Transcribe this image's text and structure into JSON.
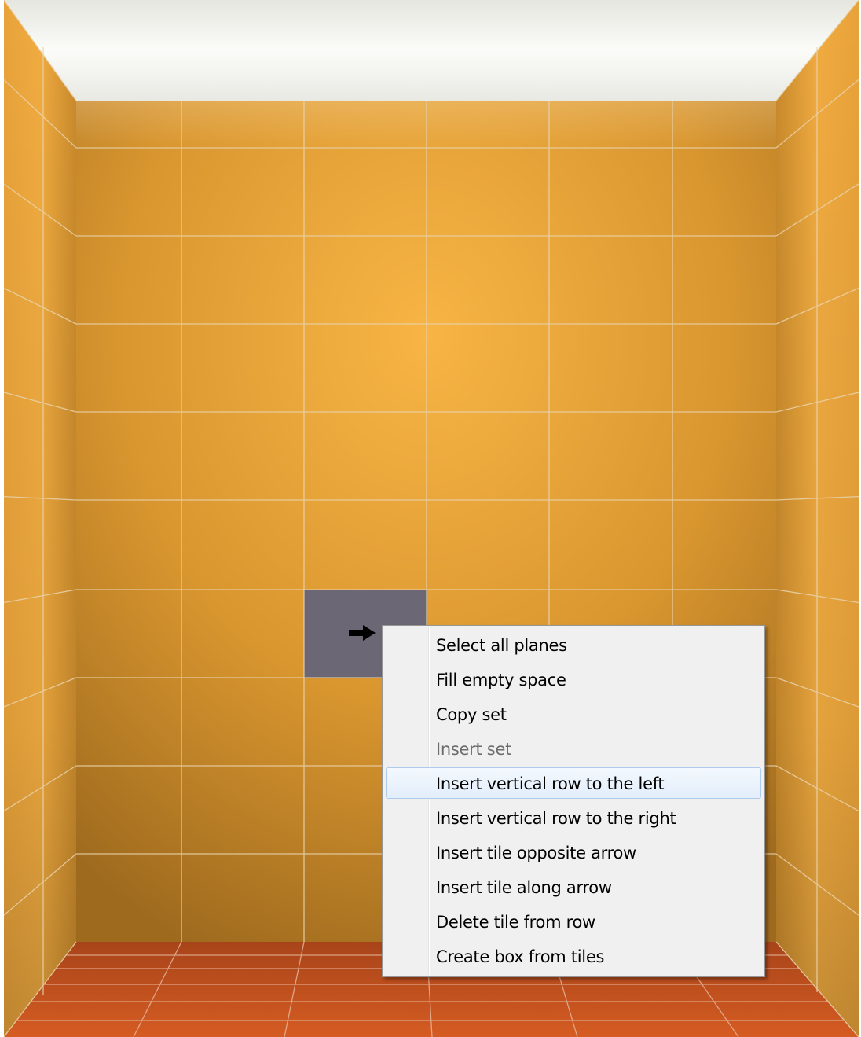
{
  "context_menu": {
    "items": [
      {
        "label": "Select all planes",
        "state": "normal"
      },
      {
        "label": "Fill empty space",
        "state": "normal"
      },
      {
        "label": "Copy set",
        "state": "normal"
      },
      {
        "label": "Insert set",
        "state": "disabled"
      },
      {
        "label": "Insert vertical row to the left",
        "state": "hover"
      },
      {
        "label": "Insert vertical row to the right",
        "state": "normal"
      },
      {
        "label": "Insert tile opposite arrow",
        "state": "normal"
      },
      {
        "label": "Insert tile along arrow",
        "state": "normal"
      },
      {
        "label": "Delete tile from row",
        "state": "normal"
      },
      {
        "label": "Create box from tiles",
        "state": "normal"
      }
    ]
  },
  "scene": {
    "wall_color": "#e8a53a",
    "floor_color": "#c9541f",
    "ceiling_color": "#f2f2ee",
    "selected_tile_color": "#6b6775",
    "grout_color": "#e7d4b0",
    "cursor_icon": "arrow-right-icon"
  }
}
